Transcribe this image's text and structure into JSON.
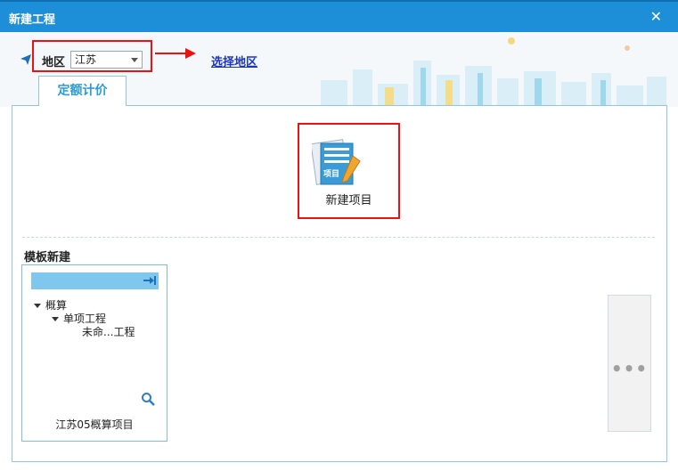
{
  "window": {
    "title": "新建工程",
    "close_glyph": "✕"
  },
  "region": {
    "label": "地区",
    "selected": "江苏",
    "link": "选择地区"
  },
  "tabs": [
    {
      "label": "定额计价"
    }
  ],
  "new_project": {
    "label": "新建项目",
    "icon_text": "项目"
  },
  "templates": {
    "title": "模板新建",
    "card": {
      "tree": [
        {
          "label": "概算"
        },
        {
          "label": "单项工程"
        },
        {
          "label": "未命...工程"
        }
      ],
      "name": "江苏05概算项目"
    }
  },
  "more": {
    "glyph": "•••"
  },
  "colors": {
    "titlebar": "#1c8fd8",
    "accent": "#2a9cd8",
    "highlight": "#e11111",
    "link": "#1b35c6"
  },
  "icons": [
    "navigation-arrow-icon",
    "red-arrow-icon",
    "document-edit-icon",
    "pin-icon",
    "search-icon",
    "more-icon",
    "close-icon"
  ]
}
